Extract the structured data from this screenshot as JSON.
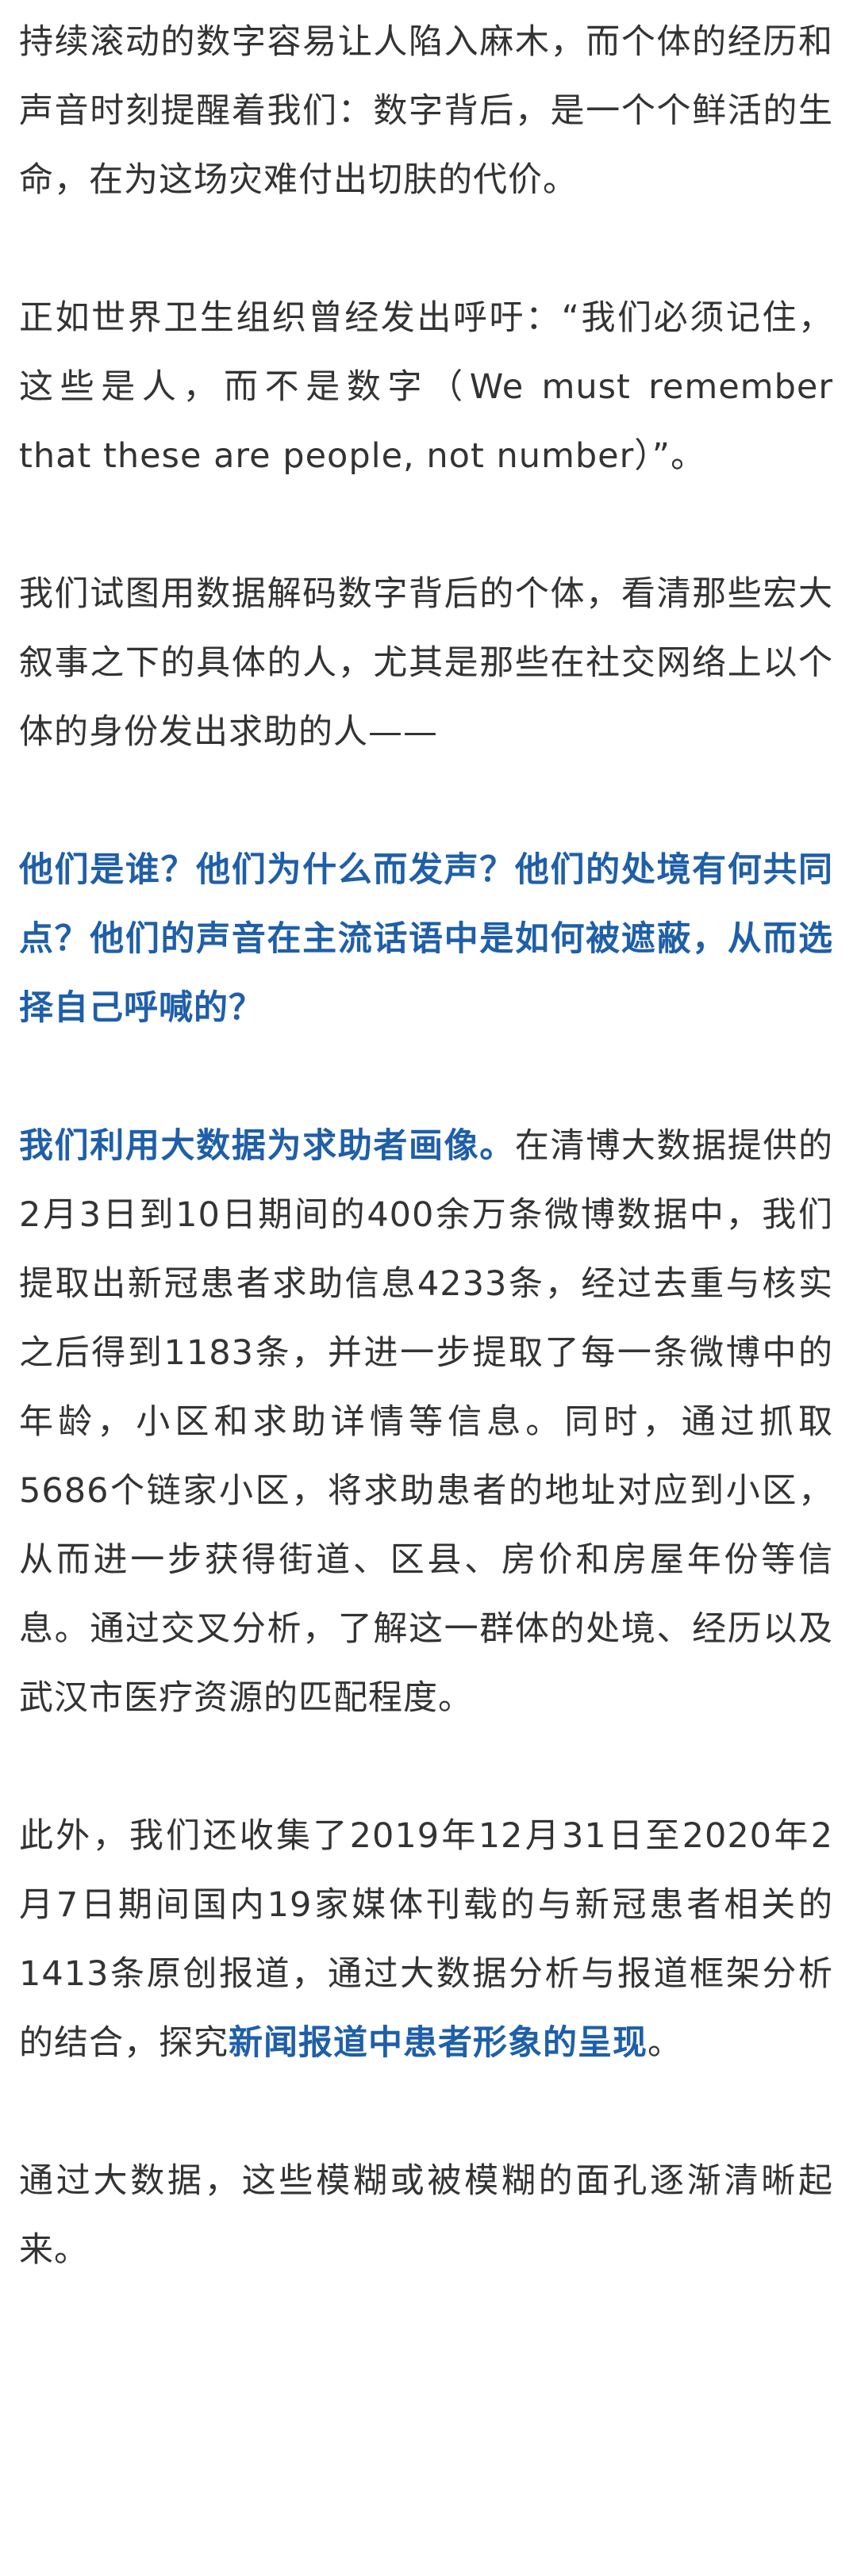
{
  "article": {
    "p1": "持续滚动的数字容易让人陷入麻木，而个体的经历和声音时刻提醒着我们：数字背后，是一个个鲜活的生命，在为这场灾难付出切肤的代价。",
    "p2": "正如世界卫生组织曾经发出呼吁：“我们必须记住，这些是人，而不是数字（We must remember that these are people, not number）”。",
    "p3": "我们试图用数据解码数字背后的个体，看清那些宏大叙事之下的具体的人，尤其是那些在社交网络上以个体的身份发出求助的人——",
    "p4": "他们是谁？他们为什么而发声？他们的处境有何共同点？他们的声音在主流话语中是如何被遮蔽，从而选择自己呼喊的？",
    "p5_highlight": "我们利用大数据为求助者画像。",
    "p5_rest": "在清博大数据提供的2月3日到10日期间的400余万条微博数据中，我们提取出新冠患者求助信息4233条，经过去重与核实之后得到1183条，并进一步提取了每一条微博中的年龄，小区和求助详情等信息。同时，通过抓取5686个链家小区，将求助患者的地址对应到小区，从而进一步获得街道、区县、房价和房屋年份等信息。通过交叉分析，了解这一群体的处境、经历以及武汉市医疗资源的匹配程度。",
    "p6_text": "此外，我们还收集了2019年12月31日至2020年2月7日期间国内19家媒体刊载的与新冠患者相关的1413条原创报道，通过大数据分析与报道框架分析的结合，探究",
    "p6_highlight": "新闻报道中患者形象的呈现",
    "p6_end": "。",
    "p7": "通过大数据，这些模糊或被模糊的面孔逐渐清晰起来。"
  },
  "colors": {
    "text": "#333333",
    "highlight": "#1f5fa8",
    "background": "#ffffff"
  }
}
